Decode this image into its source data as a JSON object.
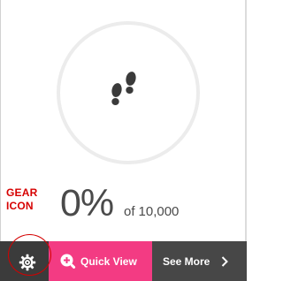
{
  "tracker": {
    "icon": "footsteps-icon",
    "progress_percent": 0,
    "percent_text": "0%",
    "goal_prefix": "of",
    "goal_value": "10,000"
  },
  "annotation": {
    "line1": "GEAR",
    "line2": "ICON",
    "color": "#d60000"
  },
  "actions": {
    "settings_icon": "gear-icon",
    "quick_view_icon": "zoom-in-icon",
    "quick_view_label": "Quick View",
    "see_more_label": "See More",
    "see_more_icon": "chevron-right-icon"
  },
  "colors": {
    "quick_view_bg": "#f33b83",
    "settings_bg": "#3b3b3b",
    "see_more_bg": "#474747",
    "text": "#4a4a4a",
    "ring": "#ececec"
  }
}
